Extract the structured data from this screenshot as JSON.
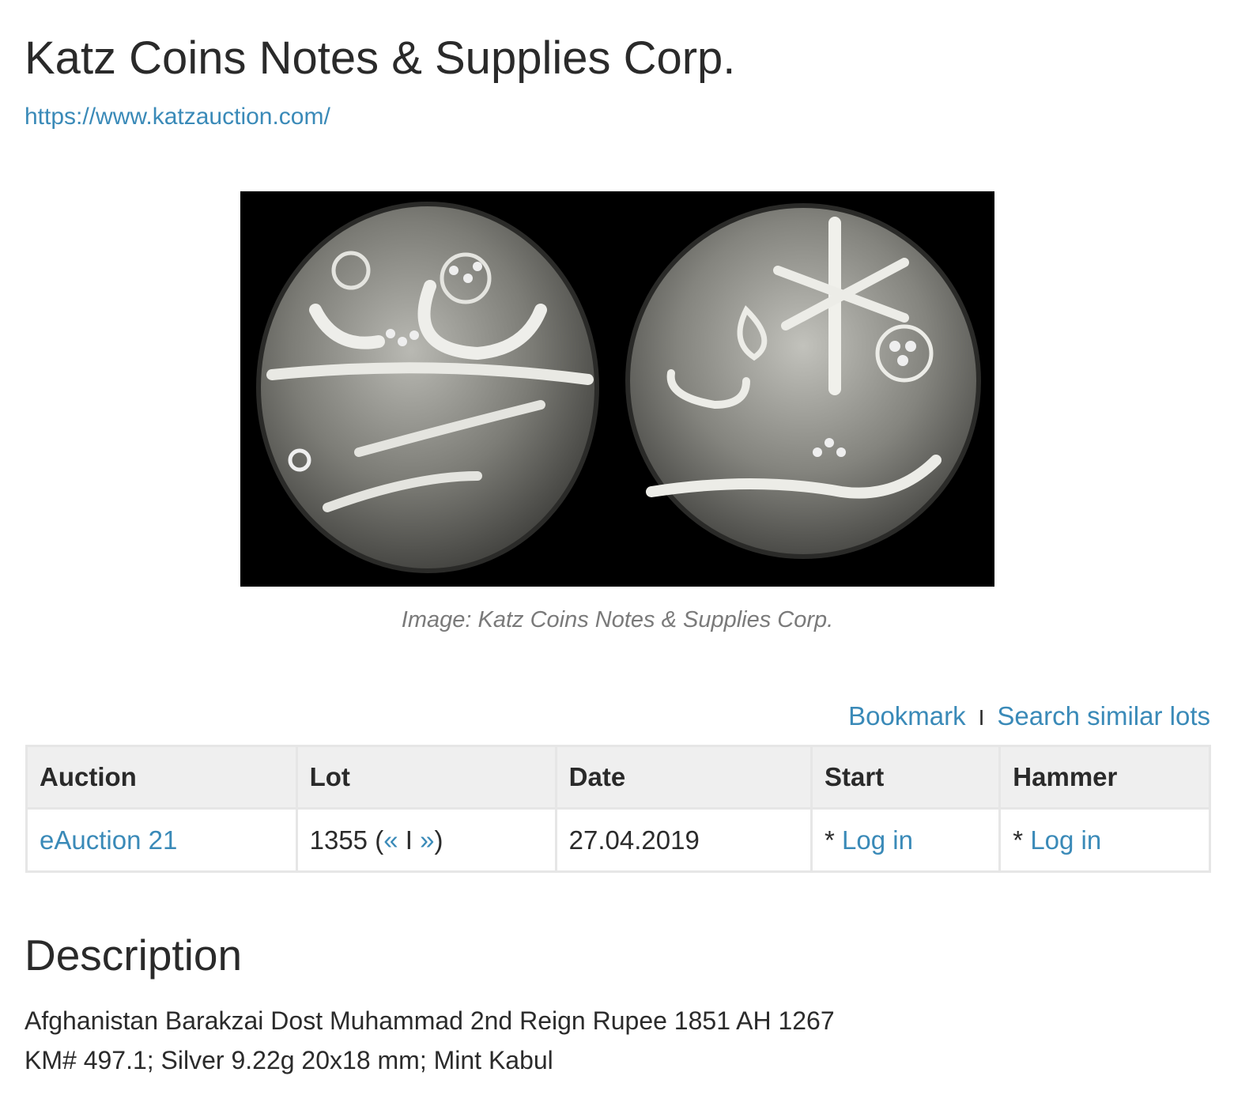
{
  "company": {
    "name": "Katz Coins Notes & Supplies Corp.",
    "url": "https://www.katzauction.com/"
  },
  "image": {
    "caption": "Image: Katz Coins Notes & Supplies Corp."
  },
  "actions": {
    "bookmark": "Bookmark",
    "separator": "I",
    "search_similar": "Search similar lots"
  },
  "table": {
    "headers": [
      "Auction",
      "Lot",
      "Date",
      "Start",
      "Hammer"
    ],
    "row": {
      "auction": "eAuction 21",
      "lot_number": "1355",
      "lot_open": "(",
      "lot_prev": "«",
      "lot_sep": "I",
      "lot_next": "»",
      "lot_close": ")",
      "date": "27.04.2019",
      "start_prefix": "*",
      "start_link": "Log in",
      "hammer_prefix": "*",
      "hammer_link": "Log in"
    }
  },
  "description": {
    "title": "Description",
    "line1": "Afghanistan Barakzai Dost Muhammad 2nd Reign Rupee 1851 AH 1267",
    "line2": "KM# 497.1; Silver 9.22g 20x18 mm; Mint Kabul"
  }
}
